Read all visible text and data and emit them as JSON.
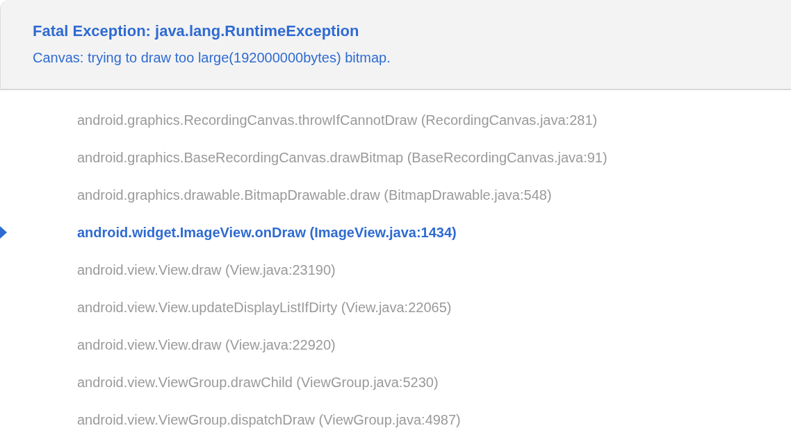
{
  "exception": {
    "title": "Fatal Exception: java.lang.RuntimeException",
    "message": "Canvas: trying to draw too large(192000000bytes) bitmap."
  },
  "frames": [
    {
      "text": "android.graphics.RecordingCanvas.throwIfCannotDraw (RecordingCanvas.java:281)",
      "selected": false
    },
    {
      "text": "android.graphics.BaseRecordingCanvas.drawBitmap (BaseRecordingCanvas.java:91)",
      "selected": false
    },
    {
      "text": "android.graphics.drawable.BitmapDrawable.draw (BitmapDrawable.java:548)",
      "selected": false
    },
    {
      "text": "android.widget.ImageView.onDraw (ImageView.java:1434)",
      "selected": true
    },
    {
      "text": "android.view.View.draw (View.java:23190)",
      "selected": false
    },
    {
      "text": "android.view.View.updateDisplayListIfDirty (View.java:22065)",
      "selected": false
    },
    {
      "text": "android.view.View.draw (View.java:22920)",
      "selected": false
    },
    {
      "text": "android.view.ViewGroup.drawChild (ViewGroup.java:5230)",
      "selected": false
    },
    {
      "text": "android.view.ViewGroup.dispatchDraw (ViewGroup.java:4987)",
      "selected": false
    }
  ]
}
